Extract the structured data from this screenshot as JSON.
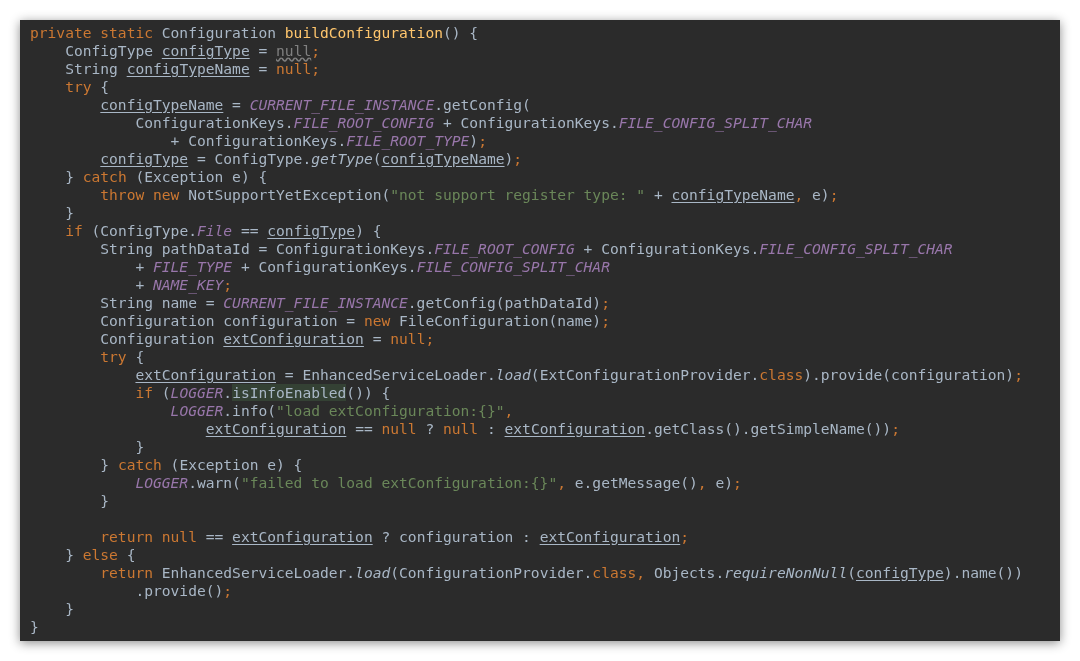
{
  "editor": {
    "lines": [
      {
        "kind": "code",
        "tokens": [
          {
            "text": "private static ",
            "kind": "keyword"
          },
          {
            "text": "Configuration ",
            "kind": "plain"
          },
          {
            "text": "buildConfiguration",
            "kind": "declaration"
          },
          {
            "text": "() {",
            "kind": "plain"
          }
        ]
      },
      {
        "kind": "code",
        "tokens": [
          {
            "text": "    ConfigType ",
            "kind": "plain"
          },
          {
            "text": "configType",
            "kind": "underlined"
          },
          {
            "text": " = ",
            "kind": "plain"
          },
          {
            "text": "null",
            "kind": "warning"
          },
          {
            "text": ";",
            "kind": "keyword"
          }
        ]
      },
      {
        "kind": "code",
        "tokens": [
          {
            "text": "    String ",
            "kind": "plain"
          },
          {
            "text": "configTypeName",
            "kind": "underlined"
          },
          {
            "text": " = ",
            "kind": "plain"
          },
          {
            "text": "null;",
            "kind": "keyword"
          }
        ]
      },
      {
        "kind": "code",
        "tokens": [
          {
            "text": "    try",
            "kind": "keyword"
          },
          {
            "text": " {",
            "kind": "plain"
          }
        ]
      },
      {
        "kind": "code",
        "tokens": [
          {
            "text": "        configTypeName",
            "kind": "underlined"
          },
          {
            "text": " = ",
            "kind": "plain"
          },
          {
            "text": "CURRENT_FILE_INSTANCE",
            "kind": "constant"
          },
          {
            "text": ".getConfig(",
            "kind": "plain"
          }
        ]
      },
      {
        "kind": "code",
        "tokens": [
          {
            "text": "            ConfigurationKeys.",
            "kind": "plain"
          },
          {
            "text": "FILE_ROOT_CONFIG",
            "kind": "constant"
          },
          {
            "text": " + ConfigurationKeys.",
            "kind": "plain"
          },
          {
            "text": "FILE_CONFIG_SPLIT_CHAR",
            "kind": "constant"
          }
        ]
      },
      {
        "kind": "code",
        "tokens": [
          {
            "text": "                + ConfigurationKeys.",
            "kind": "plain"
          },
          {
            "text": "FILE_ROOT_TYPE",
            "kind": "constant"
          },
          {
            "text": ")",
            "kind": "plain"
          },
          {
            "text": ";",
            "kind": "keyword"
          }
        ]
      },
      {
        "kind": "code",
        "tokens": [
          {
            "text": "        configType",
            "kind": "underlined"
          },
          {
            "text": " = ConfigType.",
            "kind": "plain"
          },
          {
            "text": "getType",
            "kind": "italic"
          },
          {
            "text": "(",
            "kind": "plain"
          },
          {
            "text": "configTypeName",
            "kind": "underlined"
          },
          {
            "text": ")",
            "kind": "plain"
          },
          {
            "text": ";",
            "kind": "keyword"
          }
        ]
      },
      {
        "kind": "code",
        "tokens": [
          {
            "text": "    } ",
            "kind": "plain"
          },
          {
            "text": "catch",
            "kind": "keyword"
          },
          {
            "text": " (Exception e) {",
            "kind": "plain"
          }
        ]
      },
      {
        "kind": "code",
        "tokens": [
          {
            "text": "        throw new ",
            "kind": "keyword"
          },
          {
            "text": "NotSupportYetException(",
            "kind": "plain"
          },
          {
            "text": "\"not support register type: \"",
            "kind": "string"
          },
          {
            "text": " + ",
            "kind": "plain"
          },
          {
            "text": "configTypeName",
            "kind": "underlined"
          },
          {
            "text": ",",
            "kind": "keyword"
          },
          {
            "text": " e)",
            "kind": "plain"
          },
          {
            "text": ";",
            "kind": "keyword"
          }
        ]
      },
      {
        "kind": "code",
        "tokens": [
          {
            "text": "    }",
            "kind": "plain"
          }
        ]
      },
      {
        "kind": "code",
        "tokens": [
          {
            "text": "    if",
            "kind": "keyword"
          },
          {
            "text": " (ConfigType.",
            "kind": "plain"
          },
          {
            "text": "File",
            "kind": "constant"
          },
          {
            "text": " == ",
            "kind": "plain"
          },
          {
            "text": "configType",
            "kind": "underlined"
          },
          {
            "text": ") {",
            "kind": "plain"
          }
        ]
      },
      {
        "kind": "code",
        "tokens": [
          {
            "text": "        String pathDataId = ConfigurationKeys.",
            "kind": "plain"
          },
          {
            "text": "FILE_ROOT_CONFIG",
            "kind": "constant"
          },
          {
            "text": " + ConfigurationKeys.",
            "kind": "plain"
          },
          {
            "text": "FILE_CONFIG_SPLIT_CHAR",
            "kind": "constant"
          }
        ]
      },
      {
        "kind": "code",
        "tokens": [
          {
            "text": "            + ",
            "kind": "plain"
          },
          {
            "text": "FILE_TYPE",
            "kind": "constant"
          },
          {
            "text": " + ConfigurationKeys.",
            "kind": "plain"
          },
          {
            "text": "FILE_CONFIG_SPLIT_CHAR",
            "kind": "constant"
          }
        ]
      },
      {
        "kind": "code",
        "tokens": [
          {
            "text": "            + ",
            "kind": "plain"
          },
          {
            "text": "NAME_KEY",
            "kind": "constant"
          },
          {
            "text": ";",
            "kind": "keyword"
          }
        ]
      },
      {
        "kind": "code",
        "tokens": [
          {
            "text": "        String name = ",
            "kind": "plain"
          },
          {
            "text": "CURRENT_FILE_INSTANCE",
            "kind": "constant"
          },
          {
            "text": ".getConfig(pathDataId)",
            "kind": "plain"
          },
          {
            "text": ";",
            "kind": "keyword"
          }
        ]
      },
      {
        "kind": "code",
        "tokens": [
          {
            "text": "        Configuration configuration = ",
            "kind": "plain"
          },
          {
            "text": "new ",
            "kind": "keyword"
          },
          {
            "text": "FileConfiguration(name)",
            "kind": "plain"
          },
          {
            "text": ";",
            "kind": "keyword"
          }
        ]
      },
      {
        "kind": "code",
        "tokens": [
          {
            "text": "        Configuration ",
            "kind": "plain"
          },
          {
            "text": "extConfiguration",
            "kind": "underlined"
          },
          {
            "text": " = ",
            "kind": "plain"
          },
          {
            "text": "null;",
            "kind": "keyword"
          }
        ]
      },
      {
        "kind": "code",
        "tokens": [
          {
            "text": "        try",
            "kind": "keyword"
          },
          {
            "text": " {",
            "kind": "plain"
          }
        ]
      },
      {
        "kind": "code",
        "tokens": [
          {
            "text": "            extConfiguration",
            "kind": "underlined"
          },
          {
            "text": " = EnhancedServiceLoader.",
            "kind": "plain"
          },
          {
            "text": "load",
            "kind": "italic"
          },
          {
            "text": "(ExtConfigurationProvider.",
            "kind": "plain"
          },
          {
            "text": "class",
            "kind": "keyword"
          },
          {
            "text": ").provide(configuration)",
            "kind": "plain"
          },
          {
            "text": ";",
            "kind": "keyword"
          }
        ]
      },
      {
        "kind": "code",
        "tokens": [
          {
            "text": "            if",
            "kind": "keyword"
          },
          {
            "text": " (",
            "kind": "plain"
          },
          {
            "text": "LOGGER",
            "kind": "constant"
          },
          {
            "text": ".",
            "kind": "plain"
          },
          {
            "text": "isInfoEnabled",
            "kind": "highlight"
          },
          {
            "text": "()) {",
            "kind": "plain"
          }
        ]
      },
      {
        "kind": "code",
        "tokens": [
          {
            "text": "                LOGGER",
            "kind": "constant"
          },
          {
            "text": ".info(",
            "kind": "plain"
          },
          {
            "text": "\"load extConfiguration:{}\"",
            "kind": "string"
          },
          {
            "text": ",",
            "kind": "keyword"
          }
        ]
      },
      {
        "kind": "code",
        "tokens": [
          {
            "text": "                    extConfiguration",
            "kind": "underlined"
          },
          {
            "text": " == ",
            "kind": "plain"
          },
          {
            "text": "null",
            "kind": "keyword"
          },
          {
            "text": " ? ",
            "kind": "plain"
          },
          {
            "text": "null",
            "kind": "keyword"
          },
          {
            "text": " : ",
            "kind": "plain"
          },
          {
            "text": "extConfiguration",
            "kind": "underlined"
          },
          {
            "text": ".getClass().getSimpleName())",
            "kind": "plain"
          },
          {
            "text": ";",
            "kind": "keyword"
          }
        ]
      },
      {
        "kind": "code",
        "tokens": [
          {
            "text": "            }",
            "kind": "plain"
          }
        ]
      },
      {
        "kind": "code",
        "tokens": [
          {
            "text": "        } ",
            "kind": "plain"
          },
          {
            "text": "catch",
            "kind": "keyword"
          },
          {
            "text": " (Exception e) {",
            "kind": "plain"
          }
        ]
      },
      {
        "kind": "code",
        "tokens": [
          {
            "text": "            LOGGER",
            "kind": "constant"
          },
          {
            "text": ".warn(",
            "kind": "plain"
          },
          {
            "text": "\"failed to load extConfiguration:{}\"",
            "kind": "string"
          },
          {
            "text": ",",
            "kind": "keyword"
          },
          {
            "text": " e.getMessage()",
            "kind": "plain"
          },
          {
            "text": ",",
            "kind": "keyword"
          },
          {
            "text": " e)",
            "kind": "plain"
          },
          {
            "text": ";",
            "kind": "keyword"
          }
        ]
      },
      {
        "kind": "code",
        "tokens": [
          {
            "text": "        }",
            "kind": "plain"
          }
        ]
      },
      {
        "kind": "blank"
      },
      {
        "kind": "code",
        "tokens": [
          {
            "text": "        return null ",
            "kind": "keyword"
          },
          {
            "text": "== ",
            "kind": "plain"
          },
          {
            "text": "extConfiguration",
            "kind": "underlined"
          },
          {
            "text": " ? configuration : ",
            "kind": "plain"
          },
          {
            "text": "extConfiguration",
            "kind": "underlined"
          },
          {
            "text": ";",
            "kind": "keyword"
          }
        ]
      },
      {
        "kind": "code",
        "tokens": [
          {
            "text": "    } ",
            "kind": "plain"
          },
          {
            "text": "else",
            "kind": "keyword"
          },
          {
            "text": " {",
            "kind": "plain"
          }
        ]
      },
      {
        "kind": "code",
        "tokens": [
          {
            "text": "        return ",
            "kind": "keyword"
          },
          {
            "text": "EnhancedServiceLoader.",
            "kind": "plain"
          },
          {
            "text": "load",
            "kind": "italic"
          },
          {
            "text": "(ConfigurationProvider.",
            "kind": "plain"
          },
          {
            "text": "class, ",
            "kind": "keyword"
          },
          {
            "text": "Objects.",
            "kind": "plain"
          },
          {
            "text": "requireNonNull",
            "kind": "italic"
          },
          {
            "text": "(",
            "kind": "plain"
          },
          {
            "text": "configType",
            "kind": "underlined"
          },
          {
            "text": ").name())",
            "kind": "plain"
          }
        ]
      },
      {
        "kind": "code",
        "tokens": [
          {
            "text": "            .provide()",
            "kind": "plain"
          },
          {
            "text": ";",
            "kind": "keyword"
          }
        ]
      },
      {
        "kind": "code",
        "tokens": [
          {
            "text": "    }",
            "kind": "plain"
          }
        ]
      },
      {
        "kind": "code",
        "tokens": [
          {
            "text": "}",
            "kind": "plain"
          }
        ]
      }
    ]
  }
}
